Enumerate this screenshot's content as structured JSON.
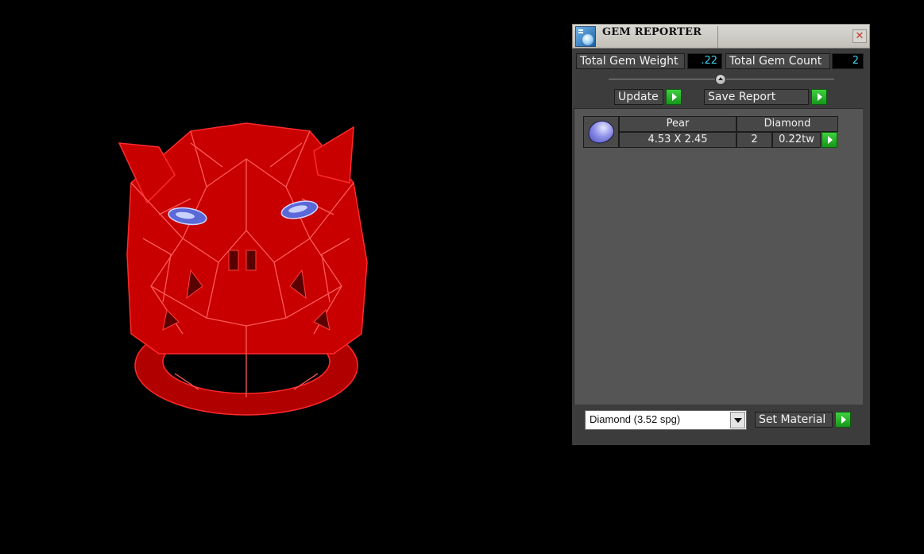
{
  "panel": {
    "title": "GEM REPORTER",
    "close_symbol": "✕",
    "total_gem_weight_label": "Total Gem Weight",
    "total_gem_weight_value": ".22",
    "total_gem_count_label": "Total Gem Count",
    "total_gem_count_value": "2",
    "update_label": "Update",
    "save_report_label": "Save Report",
    "gem_rows": [
      {
        "shape": "Pear",
        "material": "Diamond",
        "dimensions": "4.53 X 2.45",
        "count": "2",
        "weight": "0.22tw"
      }
    ],
    "material_select_value": "Diamond    (3.52 spg)",
    "set_material_label": "Set Material"
  },
  "colors": {
    "model": "#e00000",
    "gem": "#8d8fe8",
    "value_text": "#3fd0e8",
    "go_button": "#22b524"
  },
  "icons": [
    "app-icon",
    "close-icon",
    "slider-knob",
    "dropdown-arrow-icon",
    "play-arrow-icon",
    "gem-pear-icon"
  ]
}
